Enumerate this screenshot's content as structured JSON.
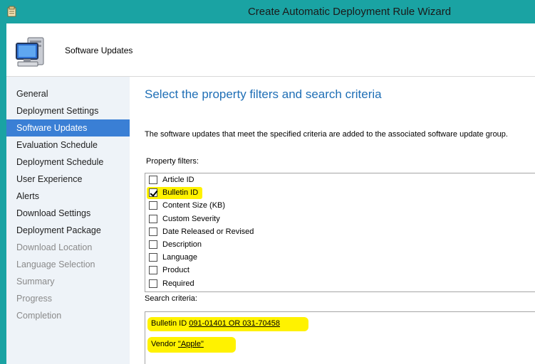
{
  "window": {
    "title": "Create Automatic Deployment Rule Wizard"
  },
  "header": {
    "title": "Software Updates",
    "icon": "computer-icon"
  },
  "sidebar": {
    "items": [
      {
        "label": "General",
        "state": "normal"
      },
      {
        "label": "Deployment Settings",
        "state": "normal"
      },
      {
        "label": "Software Updates",
        "state": "selected"
      },
      {
        "label": "Evaluation Schedule",
        "state": "normal"
      },
      {
        "label": "Deployment Schedule",
        "state": "normal"
      },
      {
        "label": "User Experience",
        "state": "normal"
      },
      {
        "label": "Alerts",
        "state": "normal"
      },
      {
        "label": "Download Settings",
        "state": "normal"
      },
      {
        "label": "Deployment Package",
        "state": "normal"
      },
      {
        "label": "Download Location",
        "state": "disabled"
      },
      {
        "label": "Language Selection",
        "state": "disabled"
      },
      {
        "label": "Summary",
        "state": "disabled"
      },
      {
        "label": "Progress",
        "state": "disabled"
      },
      {
        "label": "Completion",
        "state": "disabled"
      }
    ]
  },
  "main": {
    "title": "Select the property filters and search criteria",
    "description": "The software updates that meet the specified criteria are added to the associated software update group.",
    "property_filters_label": "Property filters:",
    "property_filters": [
      {
        "label": "Article ID",
        "checked": false
      },
      {
        "label": "Bulletin ID",
        "checked": true
      },
      {
        "label": "Content Size (KB)",
        "checked": false
      },
      {
        "label": "Custom Severity",
        "checked": false
      },
      {
        "label": "Date Released or Revised",
        "checked": false
      },
      {
        "label": "Description",
        "checked": false
      },
      {
        "label": "Language",
        "checked": false
      },
      {
        "label": "Product",
        "checked": false
      },
      {
        "label": "Required",
        "checked": false
      }
    ],
    "search_criteria_label": "Search criteria:",
    "criteria": {
      "bulletin_prefix": "Bulletin ID ",
      "bulletin_value": "091-01401 OR 031-70458",
      "vendor_prefix": "Vendor ",
      "vendor_value": "\"Apple\""
    }
  },
  "colors": {
    "frame": "#1aa3a3",
    "selected": "#3a7fd5",
    "title_blue": "#1f6fb6",
    "highlight": "#fff200"
  }
}
